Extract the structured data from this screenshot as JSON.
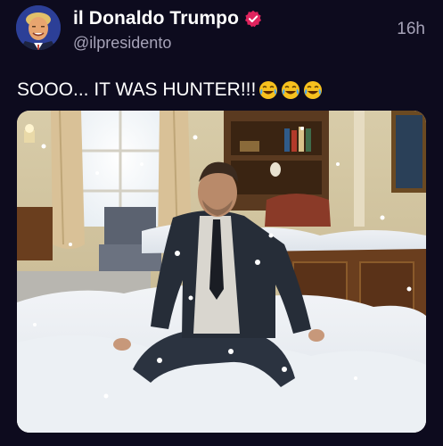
{
  "post": {
    "display_name": "il Donaldo Trumpo",
    "handle": "@ilpresidento",
    "timestamp": "16h",
    "text": "SOOO... IT WAS HUNTER!!!",
    "emojis": [
      "face-with-tears-of-joy",
      "face-with-tears-of-joy",
      "face-with-tears-of-joy"
    ],
    "verified_badge_color": "#e0245e",
    "media_description_icon": "image-photo"
  },
  "colors": {
    "background": "#0d0b1e",
    "text_primary": "#ffffff",
    "text_secondary": "#a6a3b8"
  }
}
